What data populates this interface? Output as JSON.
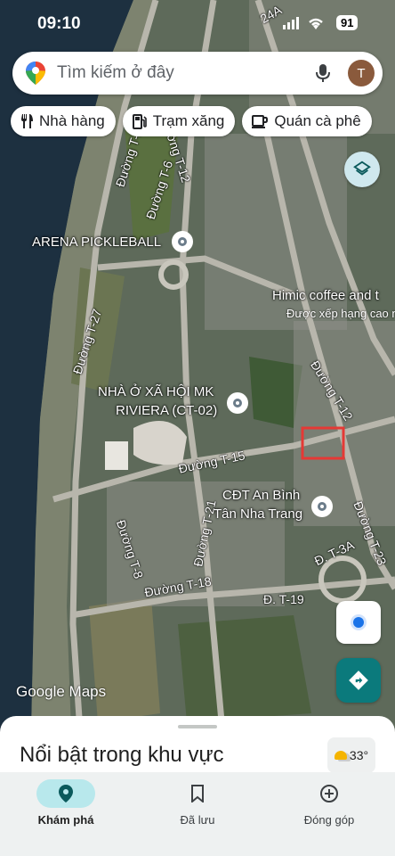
{
  "status_bar": {
    "time": "09:10",
    "battery": "91"
  },
  "search": {
    "placeholder": "Tìm kiếm ở đây",
    "avatar_letter": "T"
  },
  "chips": [
    {
      "label": "Nhà hàng",
      "icon": "fork-knife-icon"
    },
    {
      "label": "Trạm xăng",
      "icon": "gas-station-icon"
    },
    {
      "label": "Quán cà phê",
      "icon": "coffee-cup-icon"
    }
  ],
  "map": {
    "road_labels": [
      "24A",
      "Đường T-27",
      "Đường T-12",
      "Đường T-6",
      "Đường T-27",
      "Đường T-12",
      "Đường T-15",
      "Đường T-21",
      "Đường T-8",
      "Đường T-18",
      "Đ. T-19",
      "Đ. T-3A",
      "Đường T-23"
    ],
    "pois": [
      {
        "name": "ARENA PICKLEBALL"
      },
      {
        "name": "Himic coffee and t",
        "sub": "Được xếp hạng cao n"
      },
      {
        "name_line1": "NHÀ Ở XÃ HỘI MK",
        "name_line2": "RIVIERA (CT-02)"
      },
      {
        "name_line1": "CĐT An Bình",
        "name_line2": "Tân Nha Trang"
      }
    ],
    "attribution": "Google Maps"
  },
  "sheet": {
    "title": "Nổi bật trong khu vực",
    "temperature": "33°"
  },
  "nav": [
    {
      "label": "Khám phá",
      "icon": "explore-pin-icon",
      "active": true
    },
    {
      "label": "Đã lưu",
      "icon": "bookmark-icon",
      "active": false
    },
    {
      "label": "Đóng góp",
      "icon": "add-circle-icon",
      "active": false
    }
  ],
  "colors": {
    "accent": "#0b7a7c",
    "active_nav": "#b8e8ec",
    "selection_box": "#e53935"
  }
}
